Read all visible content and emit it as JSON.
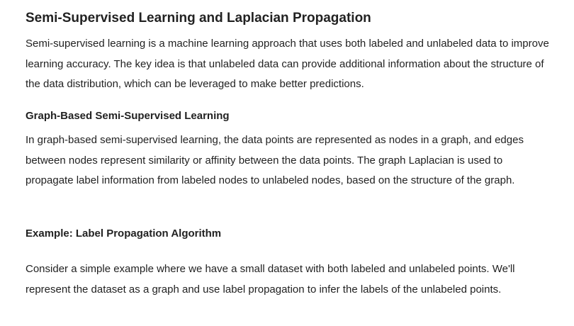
{
  "article": {
    "title": "Semi-Supervised Learning and Laplacian Propagation",
    "intro": "Semi-supervised learning is a machine learning approach that uses both labeled and unlabeled data to improve learning accuracy. The key idea is that unlabeled data can provide additional information about the structure of the data distribution, which can be leveraged to make better predictions.",
    "section_graph": {
      "heading": "Graph-Based Semi-Supervised Learning",
      "body": "In graph-based semi-supervised learning, the data points are represented as nodes in a graph, and edges between nodes represent similarity or affinity between the data points. The graph Laplacian is used to propagate label information from labeled nodes to unlabeled nodes, based on the structure of the graph."
    },
    "section_example": {
      "heading": "Example: Label Propagation Algorithm",
      "body": "Consider a simple example where we have a small dataset with both labeled and unlabeled points. We'll represent the dataset as a graph and use label propagation to infer the labels of the unlabeled points."
    }
  }
}
